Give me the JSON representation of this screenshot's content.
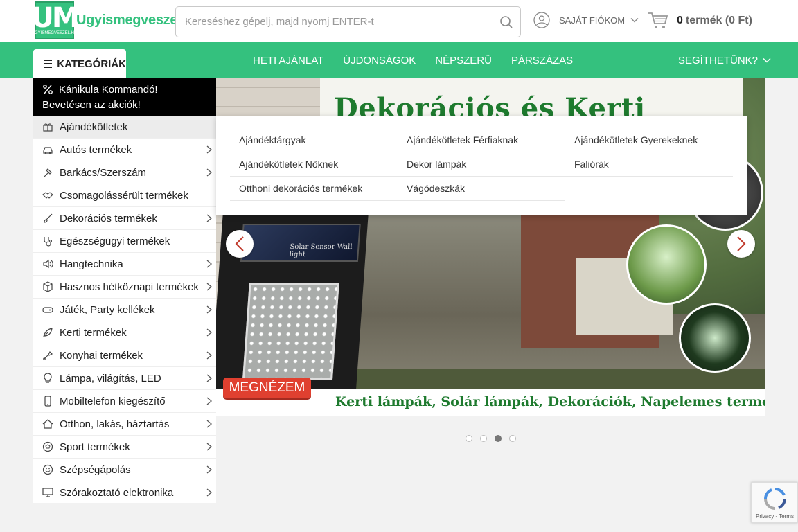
{
  "header": {
    "logo_mark": "UM",
    "logo_small": "UGYISMEGVESZEL.HU",
    "logo_text": "Ugyismegveszel",
    "search_placeholder": "Kereséshez gépelj, majd nyomj ENTER-t",
    "account_label": "SAJÁT FIÓKOM",
    "cart_count": "0",
    "cart_rest": "termék (0 Ft)"
  },
  "nav": {
    "categories_label": "KATEGÓRIÁK",
    "links": [
      "HETI AJÁNLAT",
      "ÚJDONSÁGOK",
      "NÉPSZERŰ",
      "PÁRSZÁZAS"
    ],
    "help_label": "SEGÍTHETÜNK?"
  },
  "sidebar": {
    "promo_line1": "Kánikula Kommandó!",
    "promo_line2": "Bevetésen az akciók!",
    "items": [
      {
        "label": "Ajándékötletek",
        "icon": "gift-icon",
        "arrow": false,
        "active": true
      },
      {
        "label": "Autós termékek",
        "icon": "car-icon",
        "arrow": true
      },
      {
        "label": "Barkács/Szerszám",
        "icon": "hammer-icon",
        "arrow": true
      },
      {
        "label": "Csomagolássérült termékek",
        "icon": "handshake-icon",
        "arrow": false
      },
      {
        "label": "Dekorációs termékek",
        "icon": "brush-icon",
        "arrow": true
      },
      {
        "label": "Egészségügyi termékek",
        "icon": "stethoscope-icon",
        "arrow": false
      },
      {
        "label": "Hangtechnika",
        "icon": "speaker-icon",
        "arrow": true
      },
      {
        "label": "Hasznos hétköznapi termékek",
        "icon": "box-icon",
        "arrow": true
      },
      {
        "label": "Játék, Party kellékek",
        "icon": "gamepad-icon",
        "arrow": true
      },
      {
        "label": "Kerti termékek",
        "icon": "leaf-icon",
        "arrow": true
      },
      {
        "label": "Konyhai termékek",
        "icon": "spatula-icon",
        "arrow": true
      },
      {
        "label": "Lámpa, világítás, LED",
        "icon": "bulb-icon",
        "arrow": true
      },
      {
        "label": "Mobiltelefon kiegészítő",
        "icon": "phone-icon",
        "arrow": true
      },
      {
        "label": "Otthon, lakás, háztartás",
        "icon": "home-icon",
        "arrow": true
      },
      {
        "label": "Sport termékek",
        "icon": "ball-icon",
        "arrow": true
      },
      {
        "label": "Szépségápolás",
        "icon": "smile-icon",
        "arrow": true
      },
      {
        "label": "Szórakoztató elektronika",
        "icon": "monitor-icon",
        "arrow": true
      }
    ]
  },
  "submenu": {
    "items": [
      "Ajándéktárgyak",
      "Ajándékötletek Férfiaknak",
      "Ajándékötletek Gyerekeknek",
      "Ajándékötletek Nőknek",
      "Dekor lámpák",
      "Faliórák",
      "Otthoni dekorációs termékek",
      "Vágódeszkák",
      ""
    ]
  },
  "banner": {
    "title": "Dekorációs és Kerti",
    "lamp_label": "Solar Sensor Wall light",
    "cta": "MEGNÉZEM",
    "caption": "Kerti lámpák, Solár lámpák, Dekorációk, Napelemes termékek",
    "slides_total": 4,
    "active_slide": 3
  },
  "recaptcha": {
    "text": "Privacy - Terms"
  },
  "colors": {
    "brand_green": "#34c17e",
    "promo_bg": "#000000",
    "cta_red": "#e04030"
  }
}
